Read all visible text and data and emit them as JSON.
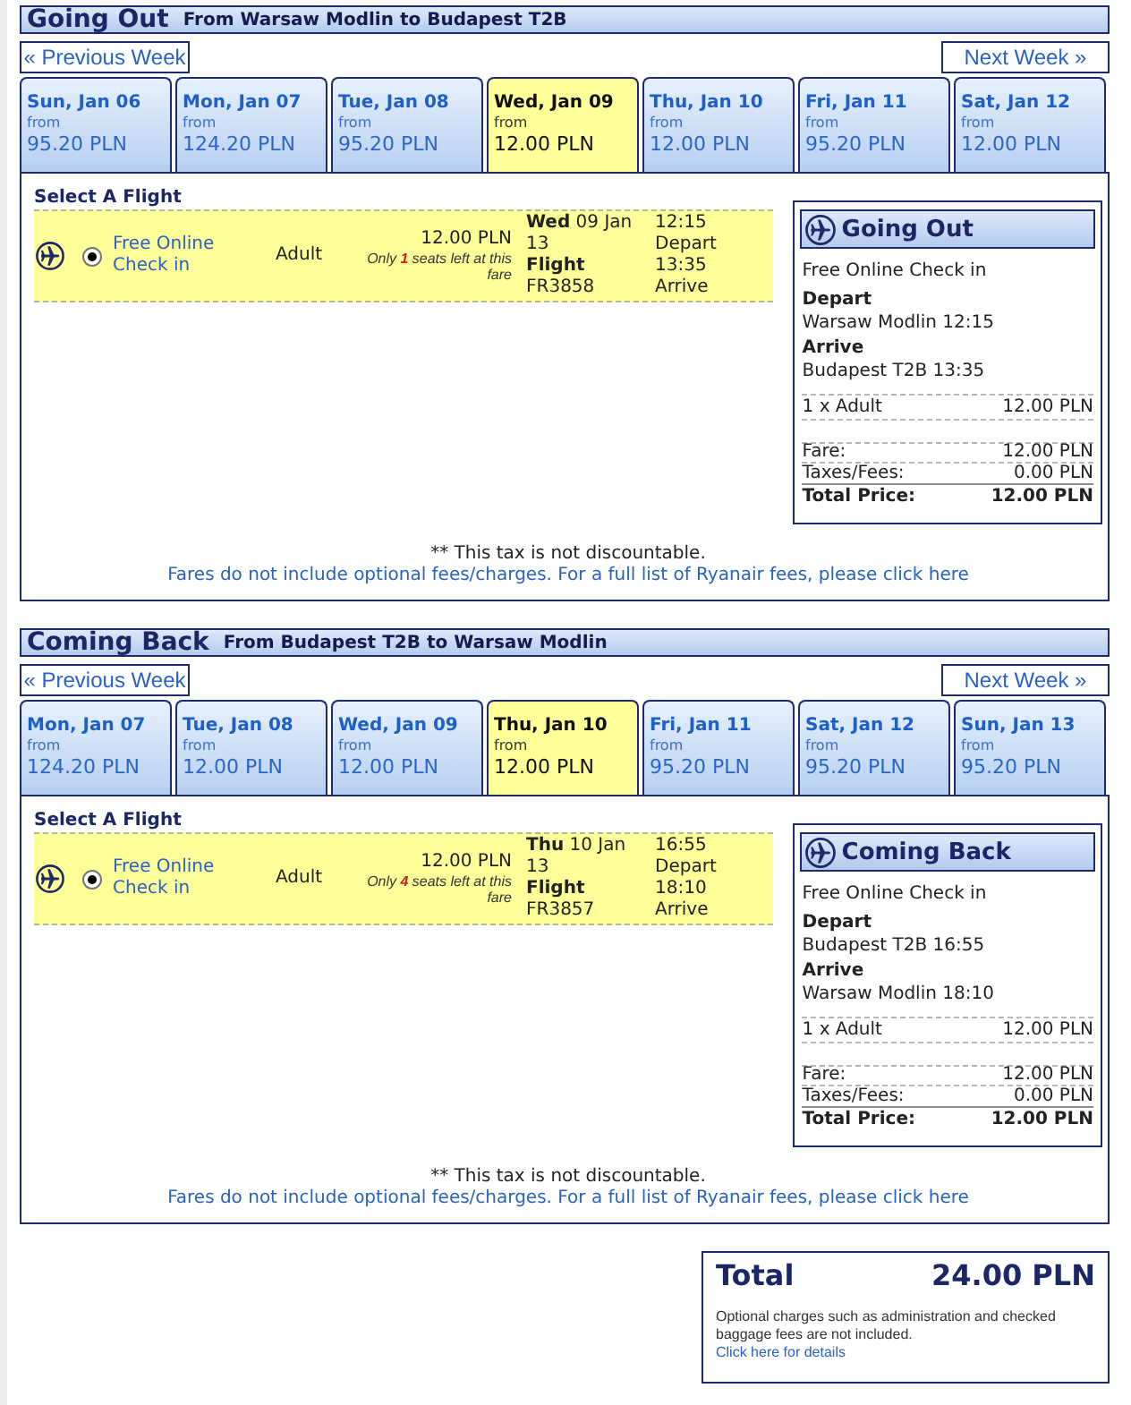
{
  "sections": [
    {
      "title": "Going Out",
      "route": "From Warsaw Modlin to Budapest T2B",
      "previous_week": "« Previous Week",
      "next_week": "Next Week »",
      "dates": [
        {
          "day": "Sun, Jan 06",
          "from_label": "from",
          "price": "95.20 PLN",
          "selected": false
        },
        {
          "day": "Mon, Jan 07",
          "from_label": "from",
          "price": "124.20 PLN",
          "selected": false
        },
        {
          "day": "Tue, Jan 08",
          "from_label": "from",
          "price": "95.20 PLN",
          "selected": false
        },
        {
          "day": "Wed, Jan 09",
          "from_label": "from",
          "price": "12.00 PLN",
          "selected": true
        },
        {
          "day": "Thu, Jan 10",
          "from_label": "from",
          "price": "12.00 PLN",
          "selected": false
        },
        {
          "day": "Fri, Jan 11",
          "from_label": "from",
          "price": "95.20 PLN",
          "selected": false
        },
        {
          "day": "Sat, Jan 12",
          "from_label": "from",
          "price": "12.00 PLN",
          "selected": false
        }
      ],
      "select_heading": "Select A Flight",
      "flights": [
        {
          "check_in": "Free Online Check in",
          "selected": true,
          "passenger": "Adult",
          "price": "12.00 PLN",
          "seats_note": "Only **1** seats left at this fare",
          "date": "**Wed** 09 Jan 13",
          "flight_label": "Flight",
          "flight_number": "FR3858",
          "depart_time": "12:15",
          "depart_label": "Depart",
          "arrive_time": "13:35",
          "arrive_label": "Arrive"
        }
      ],
      "summary": {
        "title": "Going Out",
        "check_in": "Free Online Check in",
        "depart_label": "Depart",
        "depart": "Warsaw Modlin 12:15",
        "arrive_label": "Arrive",
        "arrive": "Budapest T2B 13:35",
        "price_rows": [
          {
            "kind": "passengers",
            "label": "1 x Adult",
            "amount": "12.00 PLN"
          },
          {
            "kind": "fare",
            "label": "Fare:",
            "amount": "12.00 PLN"
          },
          {
            "kind": "taxes",
            "label": "Taxes/Fees:",
            "amount": "0.00 PLN"
          },
          {
            "kind": "total",
            "label": "Total Price:",
            "amount": "12.00 PLN"
          }
        ]
      },
      "tax_note": "** This tax is not discountable.",
      "fees_link": "Fares do not include optional fees/charges. For a full list of Ryanair fees, please click here"
    },
    {
      "title": "Coming Back",
      "route": "From Budapest T2B to Warsaw Modlin",
      "previous_week": "« Previous Week",
      "next_week": "Next Week »",
      "dates": [
        {
          "day": "Mon, Jan 07",
          "from_label": "from",
          "price": "124.20 PLN",
          "selected": false
        },
        {
          "day": "Tue, Jan 08",
          "from_label": "from",
          "price": "12.00 PLN",
          "selected": false
        },
        {
          "day": "Wed, Jan 09",
          "from_label": "from",
          "price": "12.00 PLN",
          "selected": false
        },
        {
          "day": "Thu, Jan 10",
          "from_label": "from",
          "price": "12.00 PLN",
          "selected": true
        },
        {
          "day": "Fri, Jan 11",
          "from_label": "from",
          "price": "95.20 PLN",
          "selected": false
        },
        {
          "day": "Sat, Jan 12",
          "from_label": "from",
          "price": "95.20 PLN",
          "selected": false
        },
        {
          "day": "Sun, Jan 13",
          "from_label": "from",
          "price": "95.20 PLN",
          "selected": false
        }
      ],
      "select_heading": "Select A Flight",
      "flights": [
        {
          "check_in": "Free Online Check in",
          "selected": true,
          "passenger": "Adult",
          "price": "12.00 PLN",
          "seats_note": "Only **4** seats left at this fare",
          "date": "**Thu** 10 Jan 13",
          "flight_label": "Flight",
          "flight_number": "FR3857",
          "depart_time": "16:55",
          "depart_label": "Depart",
          "arrive_time": "18:10",
          "arrive_label": "Arrive"
        }
      ],
      "summary": {
        "title": "Coming Back",
        "check_in": "Free Online Check in",
        "depart_label": "Depart",
        "depart": "Budapest T2B 16:55",
        "arrive_label": "Arrive",
        "arrive": "Warsaw Modlin 18:10",
        "price_rows": [
          {
            "kind": "passengers",
            "label": "1 x Adult",
            "amount": "12.00 PLN"
          },
          {
            "kind": "fare",
            "label": "Fare:",
            "amount": "12.00 PLN"
          },
          {
            "kind": "taxes",
            "label": "Taxes/Fees:",
            "amount": "0.00 PLN"
          },
          {
            "kind": "total",
            "label": "Total Price:",
            "amount": "12.00 PLN"
          }
        ]
      },
      "tax_note": "** This tax is not discountable.",
      "fees_link": "Fares do not include optional fees/charges. For a full list of Ryanair fees, please click here"
    }
  ],
  "total": {
    "label": "Total",
    "amount": "24.00 PLN",
    "note": "Optional charges such as administration and checked baggage fees are not included.",
    "details_link": "Click here for details"
  }
}
